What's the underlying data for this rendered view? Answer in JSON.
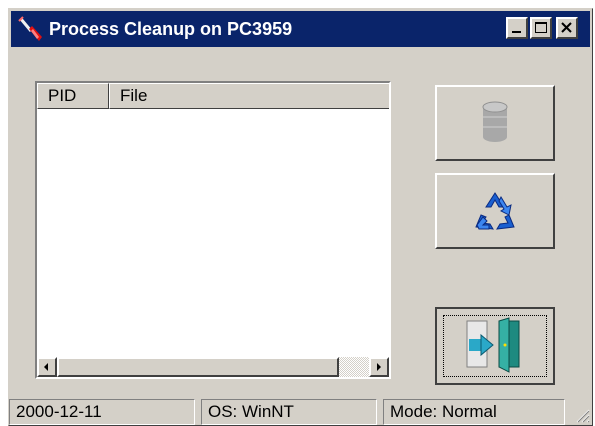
{
  "window": {
    "title": "Process Cleanup on PC3959",
    "app_icon": "broom-icon",
    "caption_buttons": [
      "minimize-icon",
      "maximize-icon",
      "close-icon"
    ]
  },
  "process_list": {
    "columns": [
      "PID",
      "File"
    ],
    "rows": []
  },
  "buttons": {
    "kill_icon": "cylinder-icon",
    "refresh_icon": "recycle-icon",
    "exit_icon": "exit-door-icon"
  },
  "statusbar": {
    "date": "2000-12-11",
    "os": "OS: WinNT",
    "mode": "Mode: Normal"
  },
  "colors": {
    "titlebar": "#0a246a",
    "face": "#d4d0c8",
    "recycle": "#1a5fd0"
  }
}
